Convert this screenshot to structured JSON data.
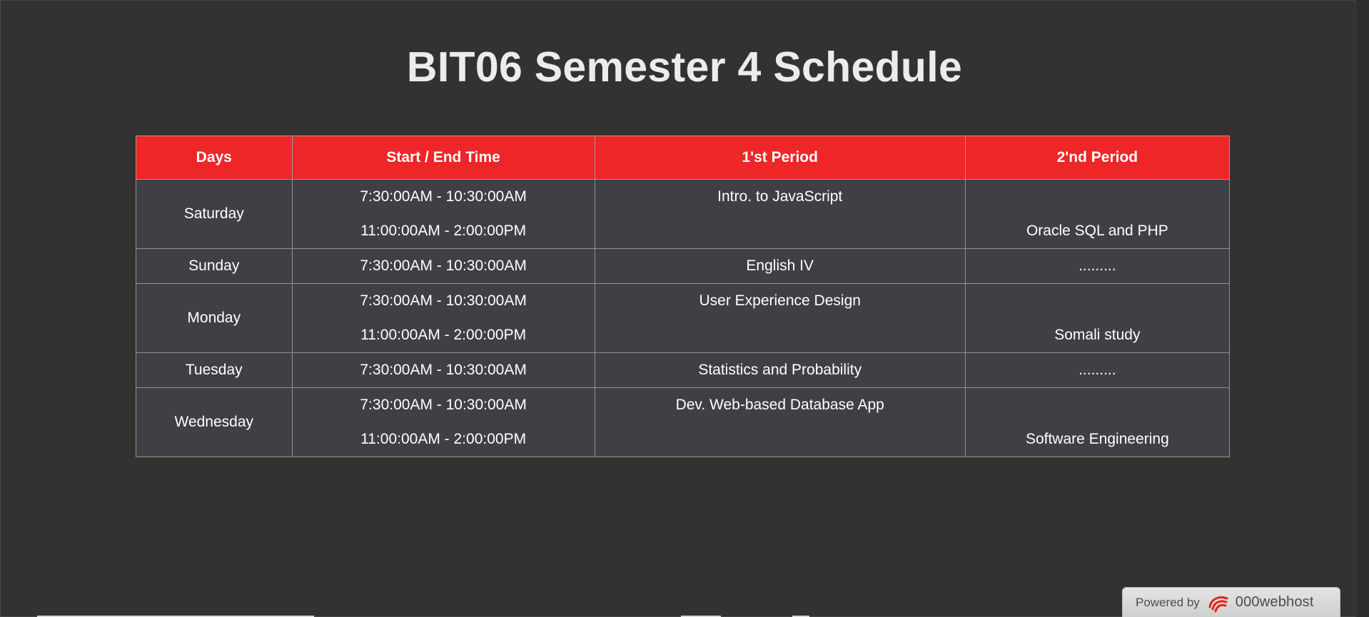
{
  "page": {
    "title": "BIT06 Semester 4 Schedule"
  },
  "table": {
    "headers": [
      "Days",
      "Start / End Time",
      "1'st Period",
      "2'nd Period"
    ],
    "rows": [
      {
        "day": "Saturday",
        "times": [
          "7:30:00AM - 10:30:00AM",
          "11:00:00AM - 2:00:00PM"
        ],
        "first_period": "Intro. to JavaScript",
        "second_period": "Oracle SQL and PHP"
      },
      {
        "day": "Sunday",
        "times": [
          "7:30:00AM - 10:30:00AM"
        ],
        "first_period": "English IV",
        "second_period": "........."
      },
      {
        "day": "Monday",
        "times": [
          "7:30:00AM - 10:30:00AM",
          "11:00:00AM - 2:00:00PM"
        ],
        "first_period": "User Experience Design",
        "second_period": "Somali study"
      },
      {
        "day": "Tuesday",
        "times": [
          "7:30:00AM - 10:30:00AM"
        ],
        "first_period": "Statistics and Probability",
        "second_period": "........."
      },
      {
        "day": "Wednesday",
        "times": [
          "7:30:00AM - 10:30:00AM",
          "11:00:00AM - 2:00:00PM"
        ],
        "first_period": "Dev. Web-based Database App",
        "second_period": "Software Engineering"
      }
    ]
  },
  "footer_badge": {
    "powered_label": "Powered by",
    "host_name": "000webhost",
    "logo_icon": "000webhost-logo-icon"
  },
  "colors": {
    "background": "#333230",
    "header_red": "#ee2628",
    "cell_bg": "#3e4045",
    "title_text": "#ececec"
  }
}
